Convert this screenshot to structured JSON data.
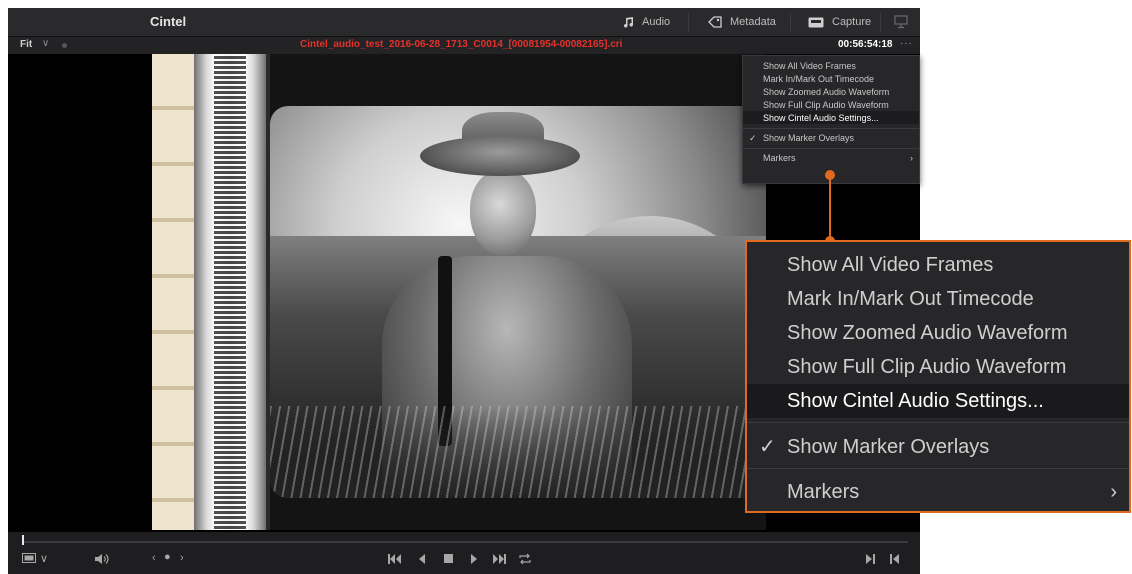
{
  "app": {
    "title": "Cintel"
  },
  "toolbar": {
    "audio_label": "Audio",
    "metadata_label": "Metadata",
    "capture_label": "Capture"
  },
  "viewer": {
    "fit_label": "Fit",
    "clip_name": "Cintel_audio_test_2016-06-28_1713_C0014_[00081954-00082165].cri",
    "timecode": "00:56:54:18",
    "more_label": "···"
  },
  "options_menu": {
    "items": [
      {
        "label": "Show All Video Frames",
        "checked": false
      },
      {
        "label": "Mark In/Mark Out Timecode",
        "checked": false
      },
      {
        "label": "Show Zoomed Audio Waveform",
        "checked": false
      },
      {
        "label": "Show Full Clip Audio Waveform",
        "checked": false
      },
      {
        "label": "Show Cintel Audio Settings...",
        "checked": false,
        "highlighted": true
      },
      {
        "label": "Show Marker Overlays",
        "checked": true
      },
      {
        "label": "Markers",
        "submenu": true
      }
    ],
    "check_glyph": "✓",
    "submenu_glyph": "›"
  },
  "colors": {
    "accent_orange": "#e06a1f",
    "clipname_red": "#e5312a"
  }
}
